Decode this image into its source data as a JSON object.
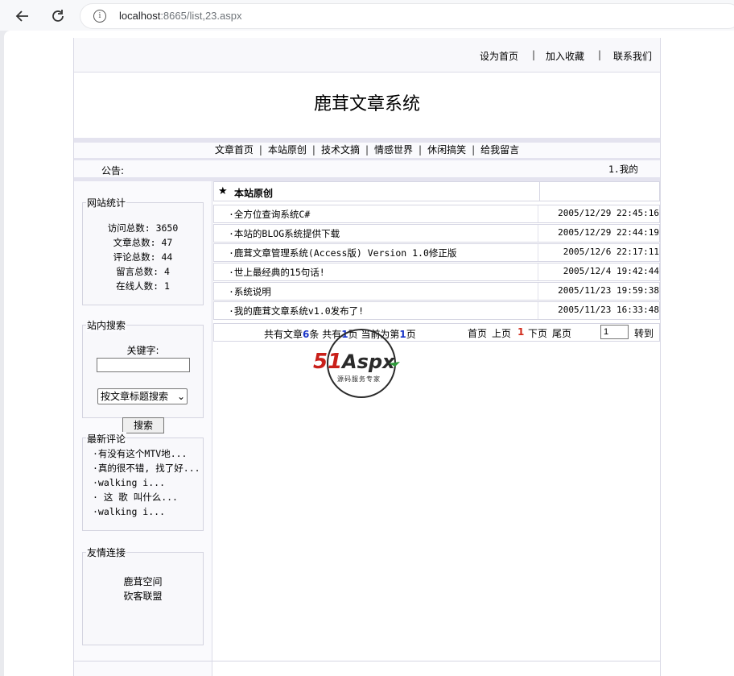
{
  "browser": {
    "url_host": "localhost",
    "url_rest": ":8665/list,23.aspx"
  },
  "toplinks": [
    "设为首页",
    "加入收藏",
    "联系我们"
  ],
  "site_title": "鹿茸文章系统",
  "menu": [
    "文章首页",
    "本站原创",
    "技术文摘",
    "情感世界",
    "休闲搞笑",
    "给我留言"
  ],
  "notice": {
    "label": "公告:",
    "ticker": "1.我的"
  },
  "stats": {
    "legend": "网站统计",
    "lines": [
      "访问总数: 3650",
      "文章总数: 47",
      "评论总数: 44",
      "留言总数: 4",
      "在线人数: 1"
    ]
  },
  "search": {
    "legend": "站内搜索",
    "keyword_label": "关键字:",
    "keyword_value": "",
    "select_value": "按文章标题搜索",
    "button": "搜索"
  },
  "comments": {
    "legend": "最新评论",
    "items": [
      "·有没有这个MTV地...",
      "·真的很不错, 找了好...",
      "·walking i...",
      "· 这 歌 叫什么...",
      "·walking i..."
    ]
  },
  "friends": {
    "legend": "友情连接",
    "items": [
      "鹿茸空间",
      "砍客联盟"
    ]
  },
  "section": {
    "star": "★",
    "title": "本站原创"
  },
  "articles": [
    {
      "title": "·全方位查询系统C#",
      "date": "2005/12/29 22:45:16"
    },
    {
      "title": "·本站的BLOG系统提供下载",
      "date": "2005/12/29 22:44:19"
    },
    {
      "title": "·鹿茸文章管理系统(Access版) Version 1.0修正版",
      "date": "2005/12/6 22:17:11"
    },
    {
      "title": "·世上最经典的15句话!",
      "date": "2005/12/4 19:42:44"
    },
    {
      "title": "·系统说明",
      "date": "2005/11/23 19:59:38"
    },
    {
      "title": "·我的鹿茸文章系统v1.0发布了!",
      "date": "2005/11/23 16:33:48"
    }
  ],
  "pager": {
    "total_prefix": "共有文章",
    "total": "6",
    "total_suffix": "条 共有",
    "pages": "1",
    "pages_suffix": "页 当前为第",
    "current": "1",
    "current_suffix": "页",
    "first": "首页",
    "prev": "上页",
    "page_num": "1",
    "next": "下页",
    "last": "尾页",
    "goto_value": "1",
    "goto_button": "转到"
  },
  "watermark": {
    "brand": "51Aspx",
    "tagline": "源码服务专家"
  },
  "colors": {
    "accent_blue": "#1a36c8",
    "accent_red": "#d12a1a",
    "band": "#e4e3ef"
  }
}
